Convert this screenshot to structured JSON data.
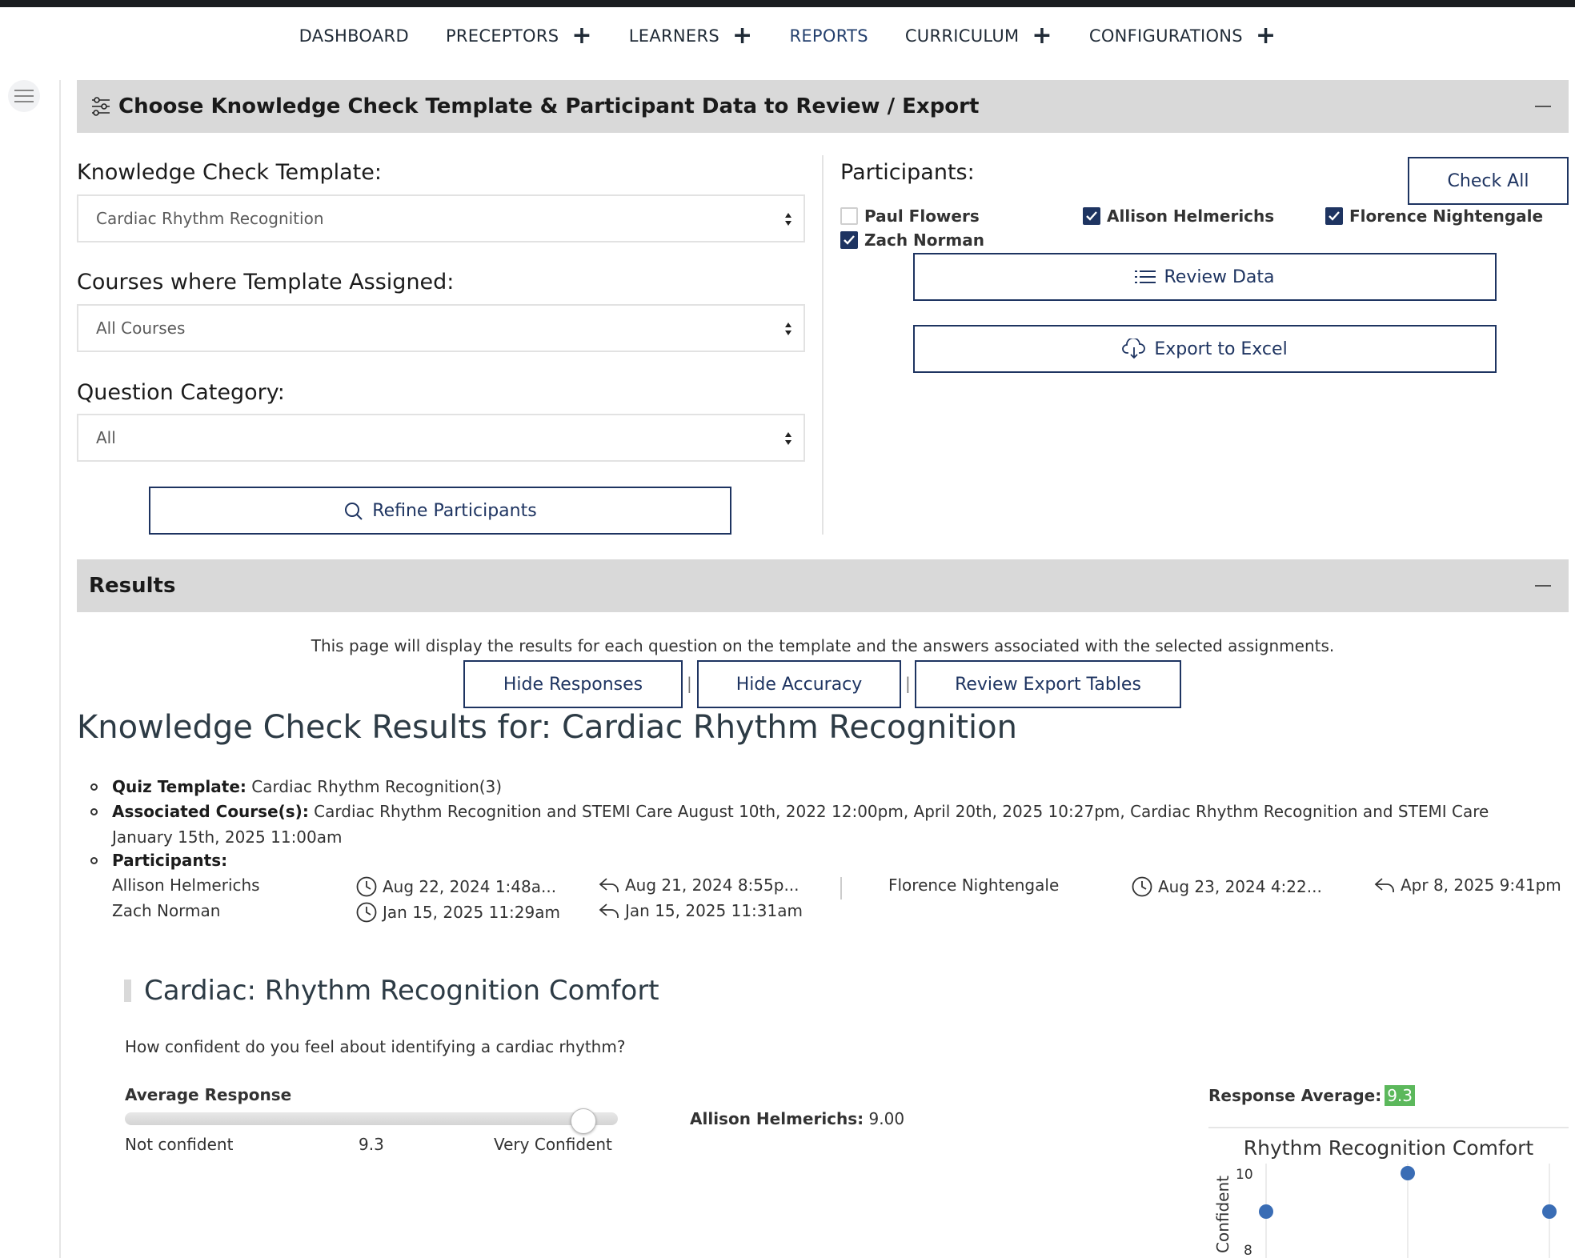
{
  "nav": {
    "items": [
      {
        "label": "DASHBOARD",
        "plus": ""
      },
      {
        "label": "PRECEPTORS",
        "plus": "+"
      },
      {
        "label": "LEARNERS",
        "plus": "+"
      },
      {
        "label": "REPORTS",
        "plus": ""
      },
      {
        "label": "CURRICULUM",
        "plus": "+"
      },
      {
        "label": "CONFIGURATIONS",
        "plus": "+"
      }
    ]
  },
  "filter_panel": {
    "title": "Choose Knowledge Check Template & Participant Data to Review / Export",
    "template_label": "Knowledge Check Template:",
    "template_value": "Cardiac Rhythm Recognition",
    "courses_label": "Courses where Template Assigned:",
    "courses_value": "All Courses",
    "category_label": "Question Category:",
    "category_value": "All",
    "refine_button": "Refine Participants",
    "participants_label": "Participants:",
    "check_all_button": "Check All",
    "participants": [
      {
        "name": "Paul Flowers",
        "checked": false
      },
      {
        "name": "Allison Helmerichs",
        "checked": true
      },
      {
        "name": "Florence Nightengale",
        "checked": true
      },
      {
        "name": "Zach Norman",
        "checked": true
      }
    ],
    "review_button": "Review Data",
    "export_button": "Export to Excel"
  },
  "results": {
    "title": "Results",
    "intro": "This page will display the results for each question on the template and the answers associated with the selected assignments.",
    "hide_responses_button": "Hide Responses",
    "hide_accuracy_button": "Hide Accuracy",
    "review_export_button": "Review Export Tables",
    "separator": "|",
    "heading": "Knowledge Check Results for: Cardiac Rhythm Recognition",
    "quiz_template_label": "Quiz Template:",
    "quiz_template_value": "Cardiac Rhythm Recognition(3)",
    "courses_label": "Associated Course(s):",
    "courses_value_line1": "Cardiac Rhythm Recognition and STEMI Care August 10th, 2022 12:00pm, April 20th, 2025 10:27pm, Cardiac Rhythm Recognition and STEMI Care",
    "courses_value_line2": "January 15th, 2025 11:00am",
    "participants_label": "Participants:",
    "participant_rows": [
      {
        "name": "Allison Helmerichs",
        "started": "Aug 22, 2024 1:48a...",
        "submitted": "Aug 21, 2024 8:55p..."
      },
      {
        "name": "Florence Nightengale",
        "started": "Aug 23, 2024 4:22...",
        "submitted": "Apr 8, 2025 9:41pm"
      },
      {
        "name": "Zach Norman",
        "started": "Jan 15, 2025 11:29am",
        "submitted": "Jan 15, 2025 11:31am"
      }
    ]
  },
  "question": {
    "title": "Cardiac: Rhythm Recognition Comfort",
    "text": "How confident do you feel about identifying a cardiac rhythm?",
    "average_label": "Average Response",
    "slider_min_label": "Not confident",
    "slider_value": "9.3",
    "slider_fraction": 0.93,
    "slider_max_label": "Very Confident",
    "response_name": "Allison Helmerichs:",
    "response_value": "9.00",
    "response_avg_label": "Response Average:",
    "response_avg_value": "9.3"
  },
  "chart_data": {
    "type": "scatter",
    "title": "Rhythm Recognition Comfort",
    "ylabel": "Confident",
    "yticks": [
      "10",
      "8"
    ],
    "ylim": [
      8,
      10
    ],
    "points": [
      {
        "x": 1,
        "y": 9
      },
      {
        "x": 2,
        "y": 10
      },
      {
        "x": 3,
        "y": 9
      }
    ],
    "point_color": "#3a6db5"
  }
}
